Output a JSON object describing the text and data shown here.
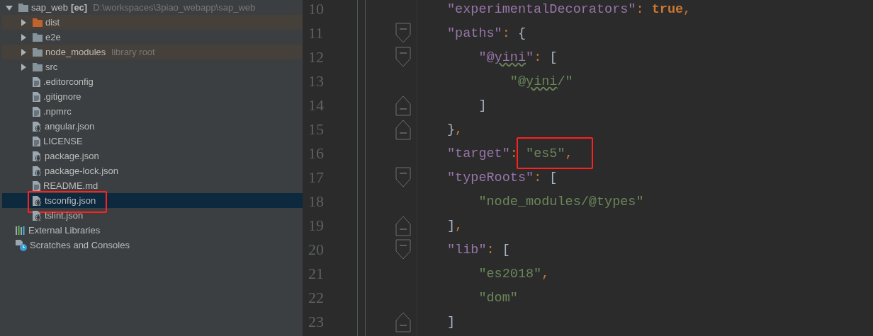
{
  "project_tree": [
    {
      "kind": "folder",
      "name": "sap_web",
      "module": "[ec]",
      "path": "D:\\workspaces\\3piao_webapp\\sap_web",
      "expanded": true,
      "selected": false,
      "children": [
        {
          "kind": "folder",
          "name": "dist",
          "color": "#c0622e",
          "highlighted": true,
          "expanded": false,
          "selected": false
        },
        {
          "kind": "folder",
          "name": "e2e",
          "color": "#87939a",
          "highlighted": false,
          "expanded": false,
          "selected": false
        },
        {
          "kind": "folder",
          "name": "node_modules",
          "note": "library root",
          "color": "#87939a",
          "highlighted": true,
          "expanded": false,
          "selected": false
        },
        {
          "kind": "folder",
          "name": "src",
          "color": "#87939a",
          "highlighted": false,
          "expanded": false,
          "selected": false
        },
        {
          "kind": "file",
          "name": ".editorconfig",
          "selected": false
        },
        {
          "kind": "file",
          "name": ".gitignore",
          "selected": false
        },
        {
          "kind": "file",
          "name": ".npmrc",
          "selected": false
        },
        {
          "kind": "json-file",
          "name": "angular.json",
          "selected": false
        },
        {
          "kind": "file",
          "name": "LICENSE",
          "selected": false
        },
        {
          "kind": "json-file",
          "name": "package.json",
          "selected": false
        },
        {
          "kind": "json-file",
          "name": "package-lock.json",
          "selected": false
        },
        {
          "kind": "file",
          "name": "README.md",
          "selected": false
        },
        {
          "kind": "json-file",
          "name": "tsconfig.json",
          "selected": true,
          "annotated": true
        },
        {
          "kind": "json-file",
          "name": "tslint.json",
          "selected": false
        }
      ]
    },
    {
      "kind": "libraries",
      "name": "External Libraries",
      "selected": false
    },
    {
      "kind": "scratches",
      "name": "Scratches and Consoles",
      "selected": false
    }
  ],
  "editor_lines": [
    {
      "number": "10",
      "fold_open": false,
      "fold_close": false,
      "tokens": [
        {
          "kind": "key",
          "text": "″experimentalDecorators″"
        },
        {
          "kind": "punct",
          "text": ": "
        },
        {
          "kind": "keyword",
          "text": "true"
        },
        {
          "kind": "punct",
          "text": ","
        }
      ]
    },
    {
      "number": "11",
      "fold_open": true,
      "fold_close": false,
      "tokens": [
        {
          "kind": "key",
          "text": "″paths″"
        },
        {
          "kind": "punct",
          "text": ": "
        },
        {
          "kind": "bracket",
          "text": "{"
        }
      ]
    },
    {
      "number": "12",
      "fold_open": true,
      "fold_close": false,
      "tokens": [
        {
          "kind": "key",
          "text": "    ″@"
        },
        {
          "kind": "key-warn",
          "text": "yini"
        },
        {
          "kind": "key",
          "text": "″"
        },
        {
          "kind": "punct",
          "text": ": "
        },
        {
          "kind": "bracket",
          "text": "["
        }
      ]
    },
    {
      "number": "13",
      "fold_open": false,
      "fold_close": false,
      "tokens": [
        {
          "kind": "string",
          "text": "        ″@"
        },
        {
          "kind": "string-warn",
          "text": "yini"
        },
        {
          "kind": "string",
          "text": "/″"
        }
      ]
    },
    {
      "number": "14",
      "fold_open": false,
      "fold_close": true,
      "tokens": [
        {
          "kind": "bracket",
          "text": "    ]"
        }
      ]
    },
    {
      "number": "15",
      "fold_open": false,
      "fold_close": true,
      "tokens": [
        {
          "kind": "bracket",
          "text": "}"
        },
        {
          "kind": "punct",
          "text": ","
        }
      ]
    },
    {
      "number": "16",
      "fold_open": false,
      "fold_close": false,
      "tokens": [
        {
          "kind": "key",
          "text": "″target″"
        },
        {
          "kind": "punct",
          "text": ":"
        },
        {
          "kind": "string",
          "text": " ″es5″",
          "annotated": true
        },
        {
          "kind": "punct",
          "text": ",",
          "annotated": true
        }
      ]
    },
    {
      "number": "17",
      "fold_open": true,
      "fold_close": false,
      "tokens": [
        {
          "kind": "key",
          "text": "″typeRoots″"
        },
        {
          "kind": "punct",
          "text": ": "
        },
        {
          "kind": "bracket",
          "text": "["
        }
      ]
    },
    {
      "number": "18",
      "fold_open": false,
      "fold_close": false,
      "tokens": [
        {
          "kind": "string",
          "text": "    ″node_modules/@types″"
        }
      ]
    },
    {
      "number": "19",
      "fold_open": false,
      "fold_close": true,
      "tokens": [
        {
          "kind": "bracket",
          "text": "]"
        },
        {
          "kind": "punct",
          "text": ","
        }
      ]
    },
    {
      "number": "20",
      "fold_open": true,
      "fold_close": false,
      "tokens": [
        {
          "kind": "key",
          "text": "″lib″"
        },
        {
          "kind": "punct",
          "text": ": "
        },
        {
          "kind": "bracket",
          "text": "["
        }
      ]
    },
    {
      "number": "21",
      "fold_open": false,
      "fold_close": false,
      "tokens": [
        {
          "kind": "string",
          "text": "    ″es2018″"
        },
        {
          "kind": "punct",
          "text": ","
        }
      ]
    },
    {
      "number": "22",
      "fold_open": false,
      "fold_close": false,
      "tokens": [
        {
          "kind": "string",
          "text": "    ″dom″"
        }
      ]
    },
    {
      "number": "23",
      "fold_open": false,
      "fold_close": true,
      "tokens": [
        {
          "kind": "bracket",
          "text": "]"
        }
      ]
    }
  ]
}
